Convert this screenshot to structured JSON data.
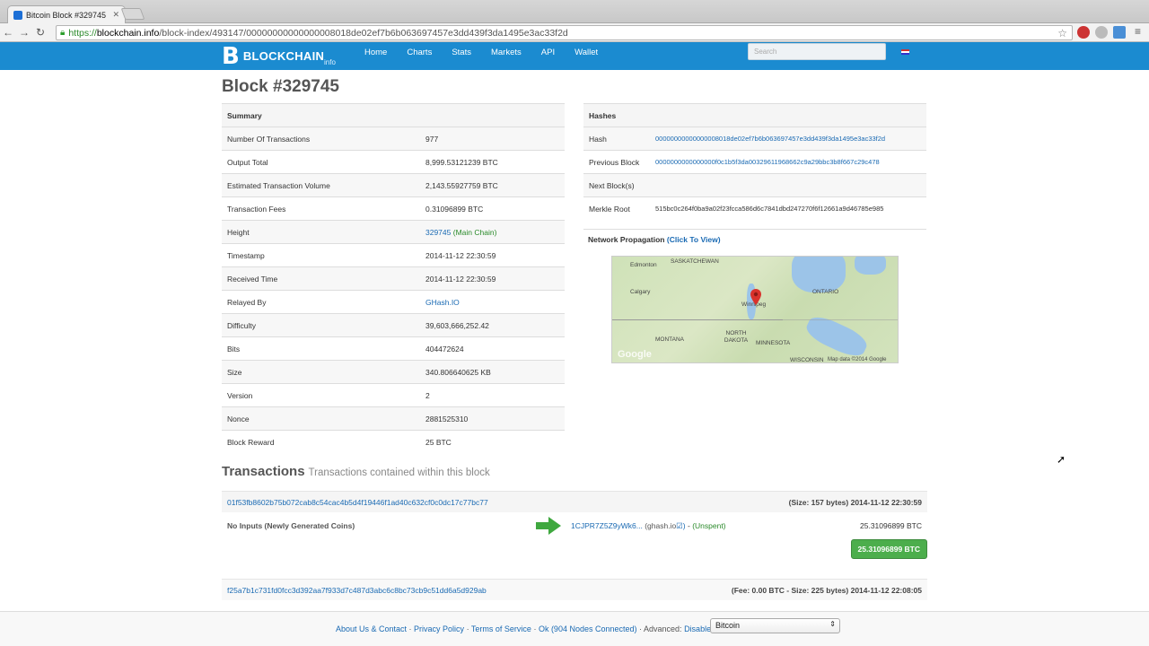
{
  "browser": {
    "tab_title": "Bitcoin Block #329745",
    "url_scheme": "https://",
    "url_host": "blockchain.info",
    "url_path": "/block-index/493147/00000000000000008018de02ef7b6b063697457e3dd439f3da1495e3ac33f2d"
  },
  "site": {
    "logo_name": "BLOCKCHAIN",
    "logo_sub": "info",
    "nav": [
      "Home",
      "Charts",
      "Stats",
      "Markets",
      "API",
      "Wallet"
    ],
    "search_placeholder": "Search"
  },
  "page": {
    "title": "Block #329745"
  },
  "summary": {
    "header": "Summary",
    "rows": [
      {
        "label": "Number Of Transactions",
        "value": "977"
      },
      {
        "label": "Output Total",
        "value": "8,999.53121239 BTC"
      },
      {
        "label": "Estimated Transaction Volume",
        "value": "2,143.55927759 BTC"
      },
      {
        "label": "Transaction Fees",
        "value": "0.31096899 BTC"
      },
      {
        "label": "Height",
        "value": "329745",
        "extra": "(Main Chain)"
      },
      {
        "label": "Timestamp",
        "value": "2014-11-12 22:30:59"
      },
      {
        "label": "Received Time",
        "value": "2014-11-12 22:30:59"
      },
      {
        "label": "Relayed By",
        "value": "GHash.IO"
      },
      {
        "label": "Difficulty",
        "value": "39,603,666,252.42"
      },
      {
        "label": "Bits",
        "value": "404472624"
      },
      {
        "label": "Size",
        "value": "340.806640625 KB"
      },
      {
        "label": "Version",
        "value": "2"
      },
      {
        "label": "Nonce",
        "value": "2881525310"
      },
      {
        "label": "Block Reward",
        "value": "25 BTC"
      }
    ]
  },
  "hashes": {
    "header": "Hashes",
    "rows": [
      {
        "label": "Hash",
        "value": "00000000000000008018de02ef7b6b063697457e3dd439f3da1495e3ac33f2d"
      },
      {
        "label": "Previous Block",
        "value": "0000000000000000f0c1b5f3da00329611968662c9a29bbc3b8f667c29c478"
      },
      {
        "label": "Next Block(s)",
        "value": ""
      },
      {
        "label": "Merkle Root",
        "value": "515bc0c264f0ba9a02f23fcca586d6c7841dbd247270f6f12661a9d46785e985"
      }
    ],
    "network_label": "Network Propagation",
    "network_link": "(Click To View)"
  },
  "map": {
    "labels": [
      "Edmonton",
      "SASKATCHEWAN",
      "Calgary",
      "ONTARIO",
      "Winnipeg",
      "MONTANA",
      "NORTH DAKOTA",
      "MINNESOTA",
      "WISCONSIN"
    ],
    "attribution": "Map data ©2014 Google",
    "brand": "Google"
  },
  "transactions": {
    "heading": "Transactions",
    "subheading": "Transactions contained within this block",
    "items": [
      {
        "hash": "01f53fb8602b75b072cab8c54cac4b5d4f19446f1ad40c632cf0c0dc17c77bc77",
        "meta": "(Size: 157 bytes) 2014-11-12 22:30:59",
        "inputs": "No Inputs (Newly Generated Coins)",
        "output_addr": "1CJPR7Z5Z9yWk6...",
        "output_tag": "(ghash.io",
        "output_status": "(Unspent)",
        "output_amount": "25.31096899 BTC",
        "total": "25.31096899 BTC"
      },
      {
        "hash": "f25a7b1c731fd0fcc3d392aa7f933d7c487d3abc6c8bc73cb9c51dd6a5d929ab",
        "meta": "(Fee: 0.00 BTC - Size: 225 bytes) 2014-11-12 22:08:05"
      }
    ]
  },
  "footer": {
    "about": "About Us & Contact",
    "privacy": "Privacy Policy",
    "terms": "Terms of Service",
    "status": "Ok (904 Nodes Connected)",
    "advanced_label": "Advanced:",
    "advanced_value": "Disable",
    "currency": "Bitcoin"
  }
}
